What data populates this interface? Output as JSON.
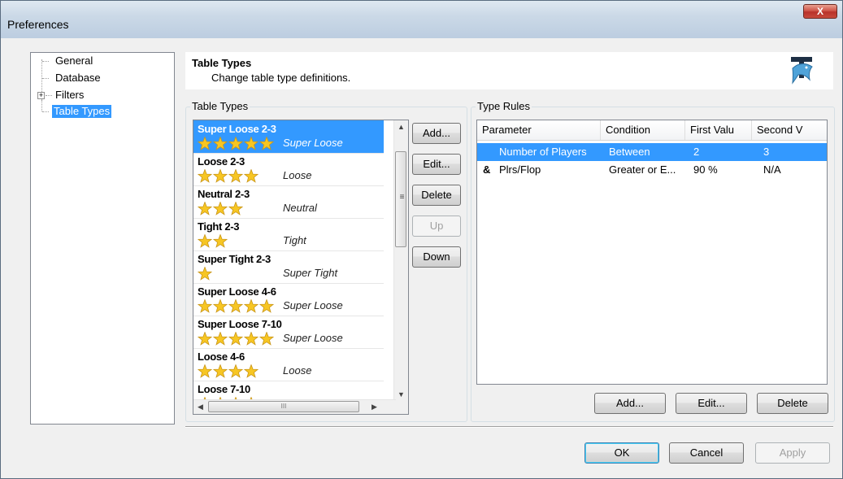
{
  "window": {
    "title": "Preferences",
    "close_glyph": "X"
  },
  "tree": {
    "items": [
      {
        "label": "General"
      },
      {
        "label": "Database"
      },
      {
        "label": "Filters",
        "expander": "+"
      },
      {
        "label": "Table Types"
      }
    ]
  },
  "header": {
    "title": "Table Types",
    "subtitle": "Change table type definitions.",
    "icon": "shark-logo-icon"
  },
  "table_types": {
    "group_label": "Table Types",
    "items": [
      {
        "name": "Super Loose 2-3",
        "stars": 5,
        "label": "Super Loose"
      },
      {
        "name": "Loose 2-3",
        "stars": 4,
        "label": "Loose"
      },
      {
        "name": "Neutral 2-3",
        "stars": 3,
        "label": "Neutral"
      },
      {
        "name": "Tight 2-3",
        "stars": 2,
        "label": "Tight"
      },
      {
        "name": "Super Tight 2-3",
        "stars": 1,
        "label": "Super Tight"
      },
      {
        "name": "Super Loose 4-6",
        "stars": 5,
        "label": "Super Loose"
      },
      {
        "name": "Super Loose 7-10",
        "stars": 5,
        "label": "Super Loose"
      },
      {
        "name": "Loose 4-6",
        "stars": 4,
        "label": "Loose"
      },
      {
        "name": "Loose 7-10",
        "stars": 4,
        "label": ""
      }
    ],
    "buttons": {
      "add": "Add...",
      "edit": "Edit...",
      "delete": "Delete",
      "up": "Up",
      "down": "Down"
    }
  },
  "type_rules": {
    "group_label": "Type Rules",
    "columns": [
      "Parameter",
      "Condition",
      "First Valu",
      "Second V"
    ],
    "rows": [
      {
        "prefix": "",
        "parameter": "Number of Players",
        "condition": "Between",
        "first": "2",
        "second": "3"
      },
      {
        "prefix": "&",
        "parameter": "Plrs/Flop",
        "condition": "Greater or E...",
        "first": "90 %",
        "second": "N/A"
      }
    ],
    "buttons": {
      "add": "Add...",
      "edit": "Edit...",
      "delete": "Delete"
    }
  },
  "footer": {
    "ok": "OK",
    "cancel": "Cancel",
    "apply": "Apply"
  },
  "scrollbar": {
    "grip": "III"
  },
  "colors": {
    "selection": "#3399ff",
    "star": "#f7c623"
  }
}
